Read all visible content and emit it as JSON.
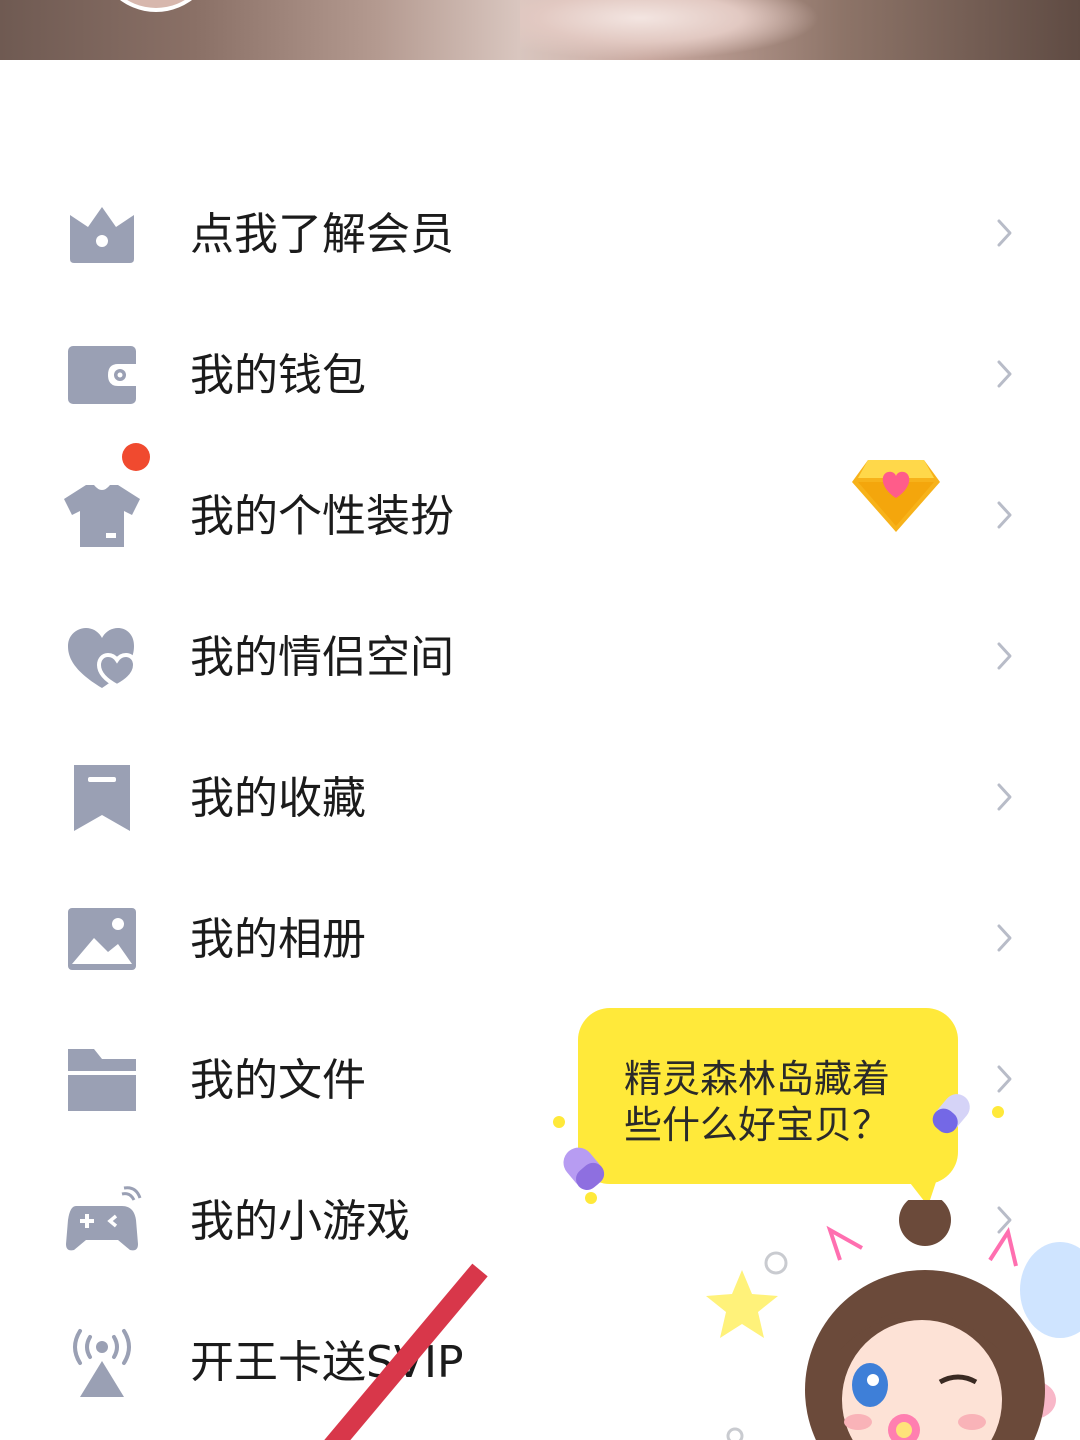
{
  "menu": {
    "items": [
      {
        "label": "点我了解会员",
        "icon": "crown-icon"
      },
      {
        "label": "我的钱包",
        "icon": "wallet-icon"
      },
      {
        "label": "我的个性装扮",
        "icon": "tshirt-icon"
      },
      {
        "label": "我的情侣空间",
        "icon": "hearts-icon",
        "has_notification_dot": true,
        "badge": "diamond-heart-icon"
      },
      {
        "label": "我的收藏",
        "icon": "bookmark-icon"
      },
      {
        "label": "我的相册",
        "icon": "photo-icon"
      },
      {
        "label": "我的文件",
        "icon": "folder-icon"
      },
      {
        "label": "我的小游戏",
        "icon": "gamepad-icon"
      },
      {
        "label": "开王卡送SVIP",
        "icon": "signal-tower-icon"
      }
    ]
  },
  "promo": {
    "bubble_line1": "精灵森林岛藏着",
    "bubble_line2": "些什么好宝贝？"
  },
  "colors": {
    "icon_gray": "#9aa0b4",
    "text": "#1b1b1b",
    "chevron": "#b8bcc8",
    "notification_dot": "#f04a2f",
    "bubble_yellow": "#ffe93a"
  }
}
